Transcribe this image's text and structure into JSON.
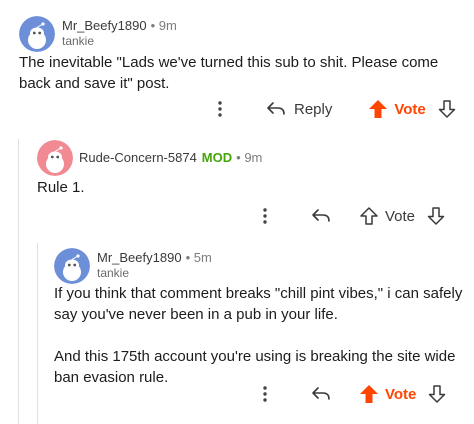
{
  "colors": {
    "upvote_active": "#ff4500",
    "mod_tag": "#46a508",
    "text": "#1c1c1c",
    "meta": "#7c7c7c",
    "thread_line": "#e0e0e0"
  },
  "comments": [
    {
      "author": "Mr_Beefy1890",
      "time": "9m",
      "flair": "tankie",
      "mod_tag": "",
      "avatar_color": "#6c8fd8",
      "avatar_icon": "snoo-avatar-icon",
      "body": [
        "The inevitable \"Lads we've turned this sub to shit. Please come back and save it\" post."
      ],
      "reply_label": "Reply",
      "vote_label": "Vote",
      "upvoted": true
    },
    {
      "author": "Rude-Concern-5874",
      "time": "9m",
      "flair": "",
      "mod_tag": "MOD",
      "avatar_color": "#f18a93",
      "avatar_icon": "snoo-avatar-icon",
      "body": [
        "Rule 1."
      ],
      "reply_label": "",
      "vote_label": "Vote",
      "upvoted": false
    },
    {
      "author": "Mr_Beefy1890",
      "time": "5m",
      "flair": "tankie",
      "mod_tag": "",
      "avatar_color": "#6c8fd8",
      "avatar_icon": "snoo-avatar-icon",
      "body": [
        "If you think that comment breaks \"chill pint vibes,\" i can safely say you've never been in a pub in your life.",
        "And this 175th account you're using is breaking the site wide ban evasion rule."
      ],
      "reply_label": "",
      "vote_label": "Vote",
      "upvoted": true
    }
  ]
}
